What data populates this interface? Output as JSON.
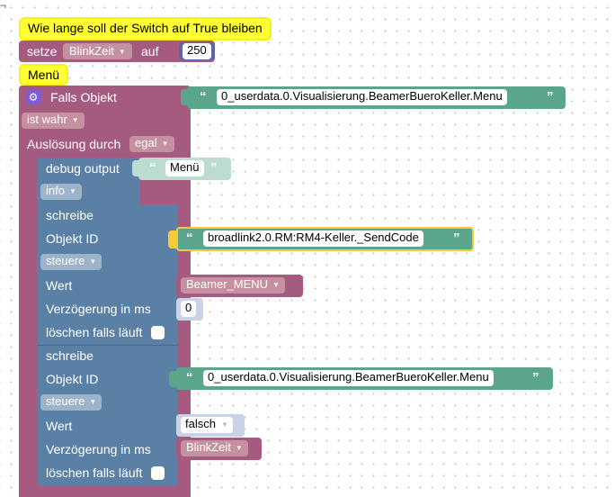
{
  "comments": {
    "switch_duration": "Wie lange soll der Switch auf True bleiben",
    "menu": "Menü"
  },
  "set_block": {
    "keyword_set": "setze",
    "variable": "BlinkZeit",
    "keyword_to": "auf",
    "value": "250"
  },
  "trigger_block": {
    "label": "Falls Objekt",
    "object_id": "0_userdata.0.Visualisierung.BeamerBueroKeller.Menu",
    "condition": "ist wahr",
    "trigger_label": "Auslösung durch",
    "trigger_value": "egal"
  },
  "debug_block": {
    "label": "debug output",
    "text": "Menü",
    "level": "info"
  },
  "write_block_1": {
    "label": "schreibe",
    "object_label": "Objekt ID",
    "object_id": "broadlink2.0.RM:RM4-Keller._SendCode",
    "mode": "steuere",
    "value_label": "Wert",
    "value": "Beamer_MENU",
    "delay_label": "Verzögerung in ms",
    "delay": "0",
    "clear_label": "löschen falls läuft"
  },
  "write_block_2": {
    "label": "schreibe",
    "object_label": "Objekt ID",
    "object_id": "0_userdata.0.Visualisierung.BeamerBueroKeller.Menu",
    "mode": "steuere",
    "value_label": "Wert",
    "value": "falsch",
    "delay_label": "Verzögerung in ms",
    "delay": "BlinkZeit",
    "clear_label": "löschen falls läuft"
  },
  "colors": {
    "event_block": "#a55b80",
    "action_block": "#5b80a5",
    "text_block": "#5ba58c",
    "comment": "#ffff33",
    "selected_outline": "#fcc936"
  },
  "icons": {
    "quote_open": "“",
    "quote_close": "”",
    "gear": "⚙",
    "corner": "⌐"
  }
}
